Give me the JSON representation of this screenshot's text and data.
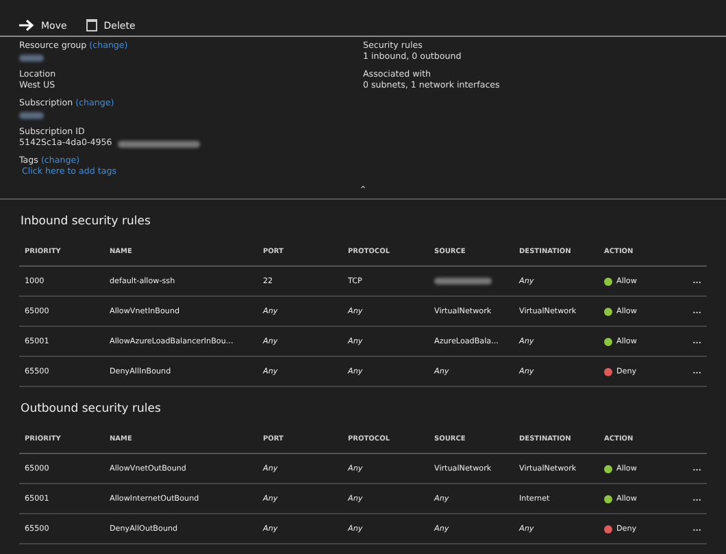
{
  "toolbar": [
    {
      "kind": "move",
      "label": "Move"
    },
    {
      "kind": "delete",
      "label": "Delete"
    }
  ],
  "essentials_left": [
    {
      "label": "Resource group",
      "link": "(change)",
      "redacted": true
    },
    {
      "label": "Location",
      "value": "West US"
    },
    {
      "label": "Subscription",
      "link": "(change)",
      "redacted": true
    },
    {
      "label": "Subscription ID",
      "value": "5142Sc1a-4da0-4956",
      "redacted": true
    },
    {
      "label": "Tags",
      "link": "(change)",
      "value_link": "Click here to add tags"
    }
  ],
  "essentials_right": [
    {
      "label": "Security rules",
      "value": "1 inbound, 0 outbound"
    },
    {
      "label": "Associated with",
      "value": "0 subnets, 1 network interfaces"
    }
  ],
  "collapse_glyph": "⌃",
  "sections": [
    {
      "title": "Inbound security rules",
      "columns": [
        "PRIORITY",
        "NAME",
        "PORT",
        "PROTOCOL",
        "SOURCE",
        "DESTINATION",
        "ACTION"
      ],
      "rows": [
        {
          "priority": "1000",
          "name": "default-allow-ssh",
          "port": "22",
          "protocol": "TCP",
          "source_redacted": true,
          "destination": "Any",
          "action": "Allow",
          "color": "#8cc63f",
          "more": "..."
        },
        {
          "priority": "65000",
          "name": "AllowVnetInBound",
          "port": "Any",
          "protocol": "Any",
          "source": "VirtualNetwork",
          "destination": "VirtualNetwork",
          "action": "Allow",
          "color": "#8cc63f",
          "more": "..."
        },
        {
          "priority": "65001",
          "name": "AllowAzureLoadBalancerInBou...",
          "port": "Any",
          "protocol": "Any",
          "source": "AzureLoadBala...",
          "destination": "Any",
          "action": "Allow",
          "color": "#8cc63f",
          "more": "..."
        },
        {
          "priority": "65500",
          "name": "DenyAllInBound",
          "port": "Any",
          "protocol": "Any",
          "source": "Any",
          "destination": "Any",
          "action": "Deny",
          "color": "#e05a5a",
          "more": "..."
        }
      ]
    },
    {
      "title": "Outbound security rules",
      "columns": [
        "PRIORITY",
        "NAME",
        "PORT",
        "PROTOCOL",
        "SOURCE",
        "DESTINATION",
        "ACTION"
      ],
      "rows": [
        {
          "priority": "65000",
          "name": "AllowVnetOutBound",
          "port": "Any",
          "protocol": "Any",
          "source": "VirtualNetwork",
          "destination": "VirtualNetwork",
          "action": "Allow",
          "color": "#8cc63f",
          "more": "..."
        },
        {
          "priority": "65001",
          "name": "AllowInternetOutBound",
          "port": "Any",
          "protocol": "Any",
          "source": "Any",
          "destination": "Internet",
          "action": "Allow",
          "color": "#8cc63f",
          "more": "..."
        },
        {
          "priority": "65500",
          "name": "DenyAllOutBound",
          "port": "Any",
          "protocol": "Any",
          "source": "Any",
          "destination": "Any",
          "action": "Deny",
          "color": "#e05a5a",
          "more": "..."
        }
      ]
    }
  ]
}
